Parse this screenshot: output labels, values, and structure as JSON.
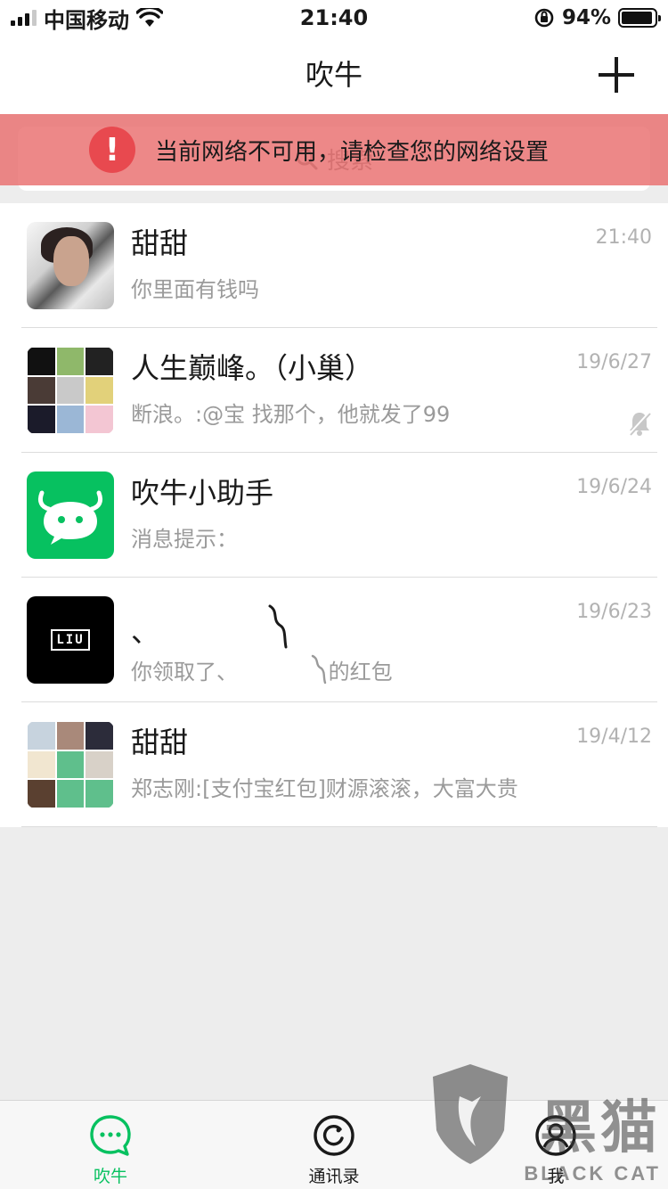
{
  "status_bar": {
    "carrier": "中国移动",
    "time": "21:40",
    "battery": "94%",
    "battery_level": 0.94
  },
  "nav": {
    "title": "吹牛",
    "add_icon": "plus-icon"
  },
  "search": {
    "placeholder": "搜索"
  },
  "banner": {
    "text": "当前网络不可用，请检查您的网络设置",
    "icon": "exclamation-icon"
  },
  "chats": [
    {
      "name": "甜甜",
      "message": "你里面有钱吗",
      "time": "21:40"
    },
    {
      "name": "人生巅峰。（小巢）",
      "message": "断浪。:@宝 找那个，他就发了99",
      "time": "19/6/27",
      "muted": true
    },
    {
      "name": "吹牛小助手",
      "message": "消息提示：",
      "time": "19/6/24"
    },
    {
      "name": "、",
      "message": "你领取了、",
      "message_suffix": "的红包",
      "time": "19/6/23",
      "avatar_text": "LIU"
    },
    {
      "name": "甜甜",
      "message": "郑志刚:[支付宝红包]财源滚滚，大富大贵",
      "time": "19/4/12"
    }
  ],
  "tabs": [
    {
      "label": "吹牛",
      "icon": "chat-bubble-icon",
      "active": true
    },
    {
      "label": "通讯录",
      "icon": "contacts-icon"
    },
    {
      "label": "我",
      "icon": "profile-icon"
    }
  ],
  "watermark": {
    "text": "黑猫",
    "subtext": "BLACK CAT"
  },
  "colors": {
    "accent": "#07c160",
    "banner": "#e86a6a"
  }
}
